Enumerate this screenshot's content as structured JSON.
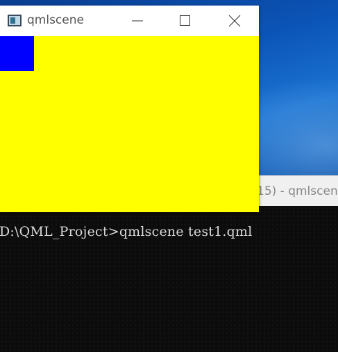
{
  "desktop": {
    "background_window_title": "15) - qmlscen"
  },
  "qml_window": {
    "title": "qmlscene",
    "icon": "app-window-icon",
    "controls": {
      "minimize_icon": "minimize-icon",
      "maximize_icon": "maximize-icon",
      "close_icon": "close-icon"
    },
    "client_color": "#ffff00",
    "rect_color": "#0000ff"
  },
  "console": {
    "line": "D:\\QML_Project>qmlscene test1.qml"
  }
}
